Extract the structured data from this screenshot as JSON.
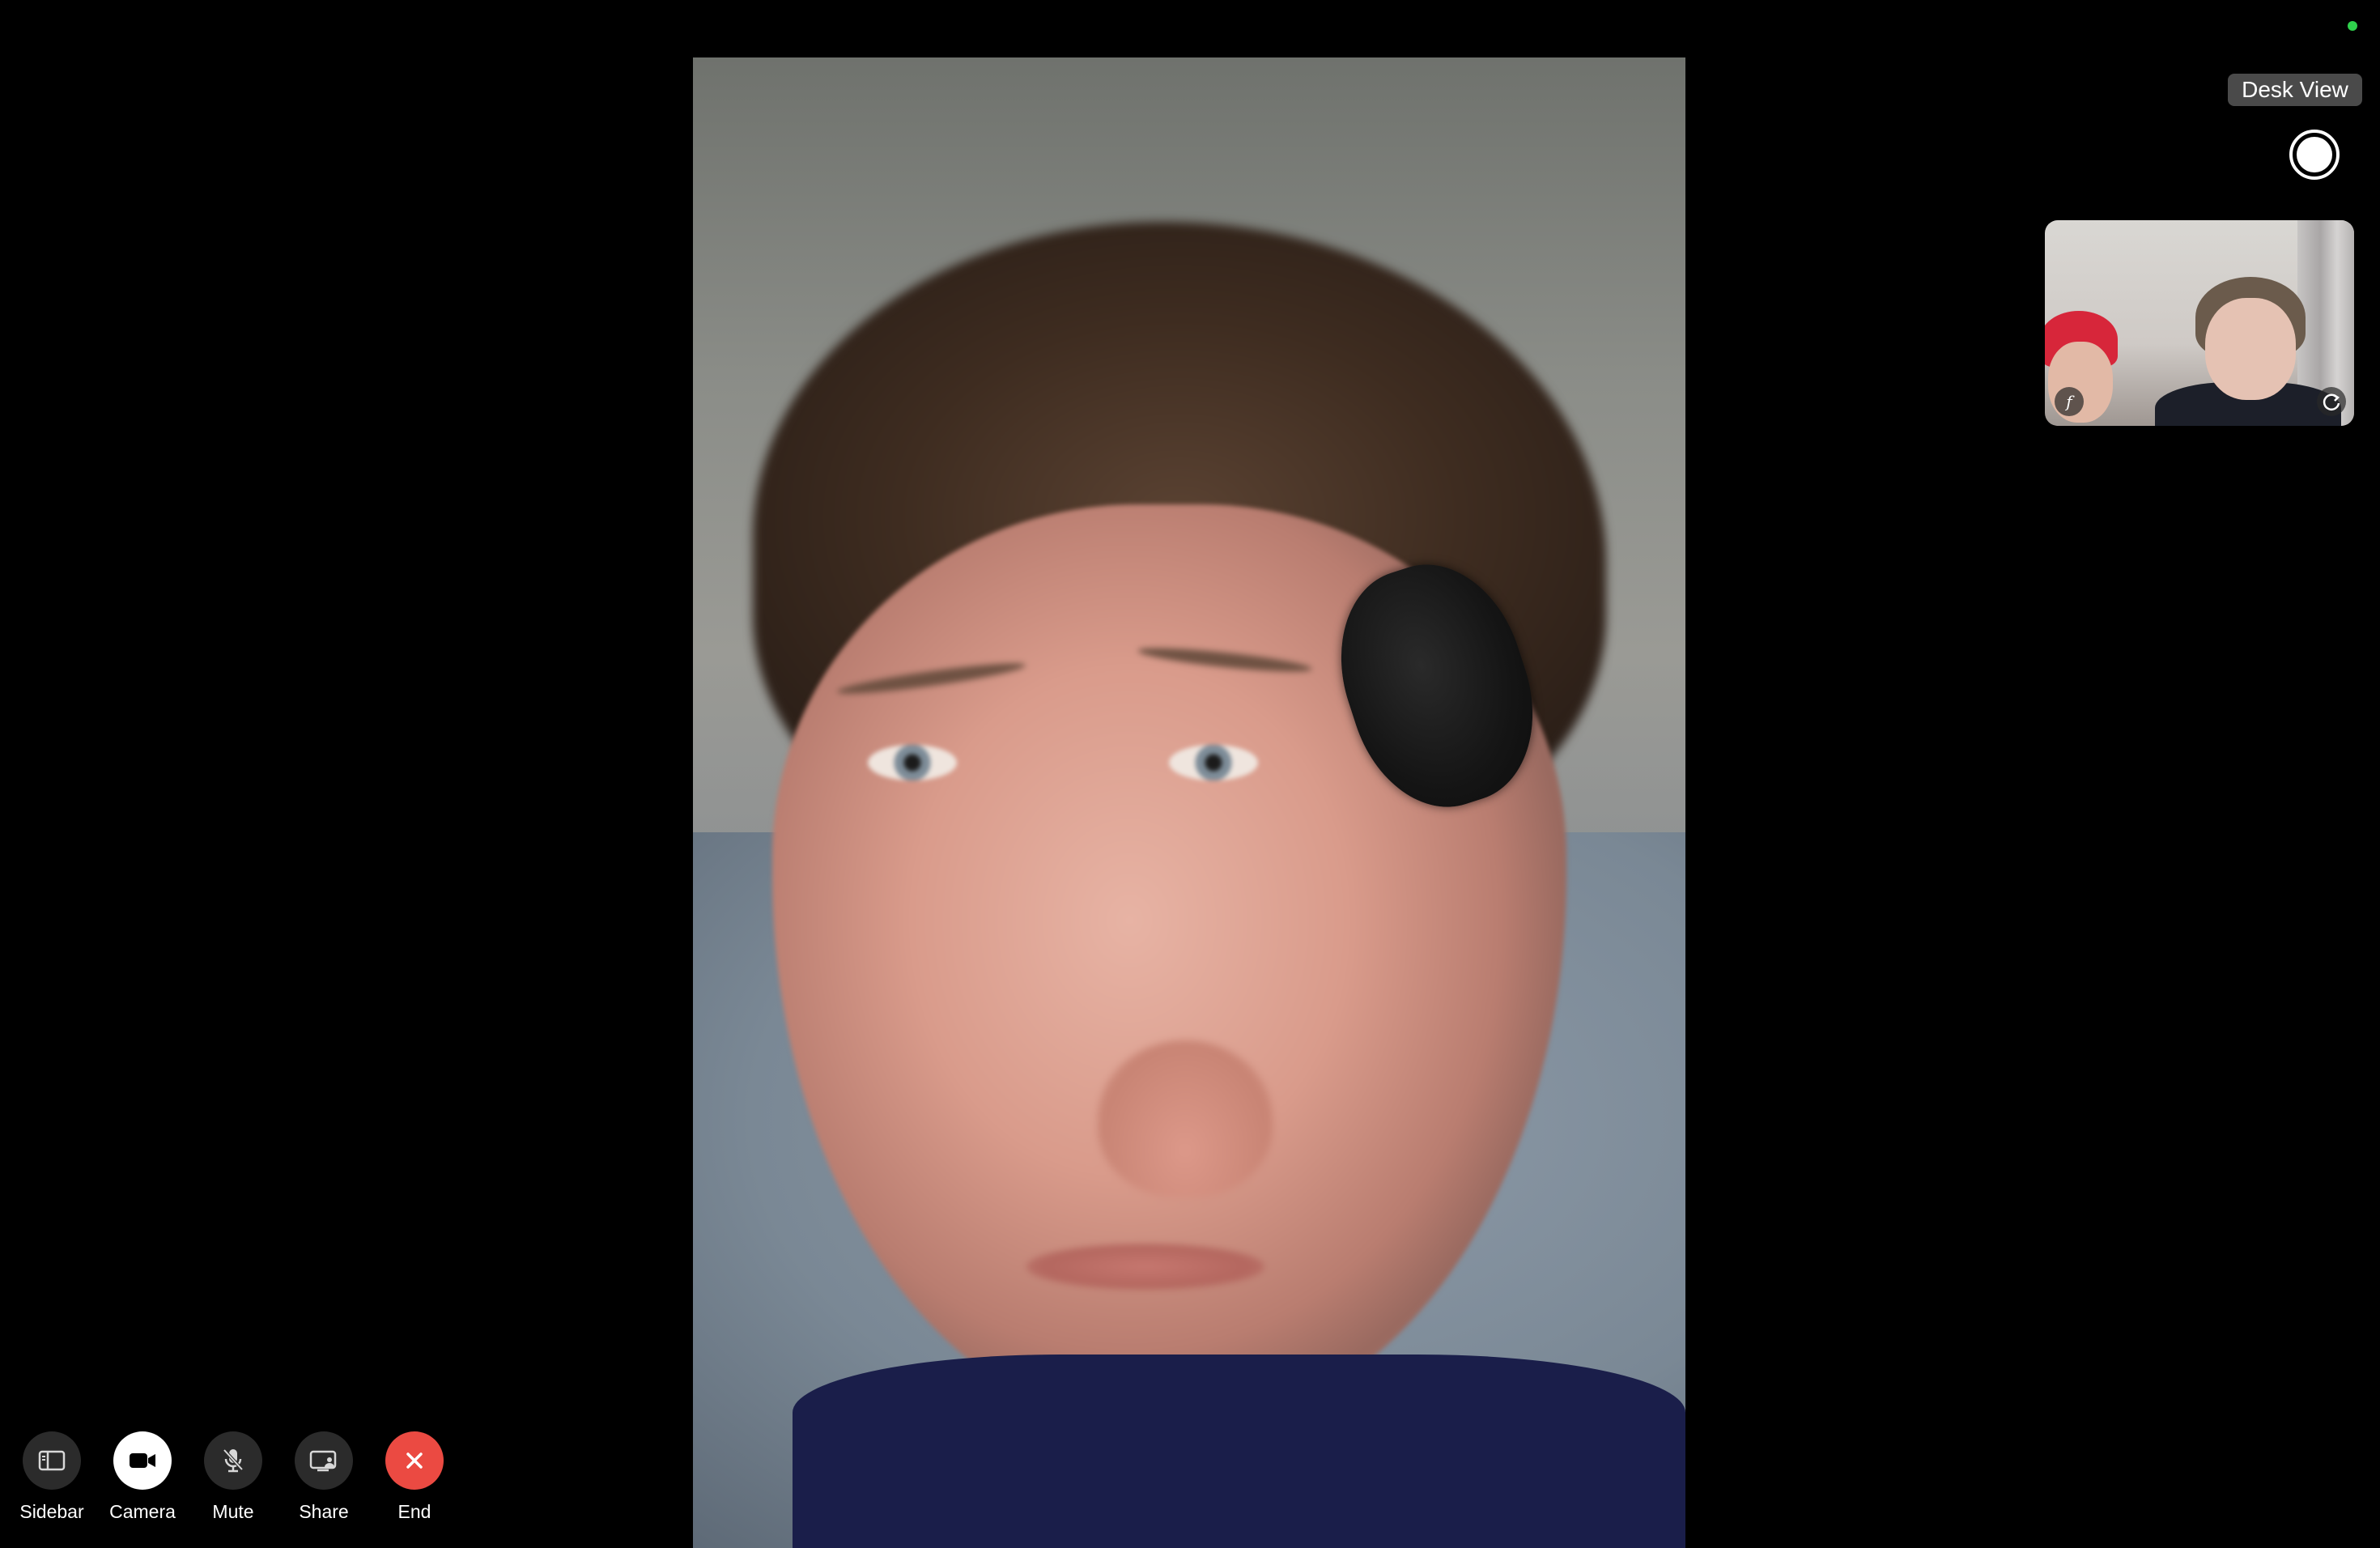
{
  "status": {
    "indicator_color": "#2fd14c"
  },
  "desk_view": {
    "label": "Desk View"
  },
  "controls": {
    "sidebar": {
      "label": "Sidebar",
      "icon": "sidebar-icon"
    },
    "camera": {
      "label": "Camera",
      "icon": "video-camera-icon"
    },
    "mute": {
      "label": "Mute",
      "icon": "microphone-icon"
    },
    "share": {
      "label": "Share",
      "icon": "screen-share-icon"
    },
    "end": {
      "label": "End",
      "icon": "close-icon",
      "color": "#eb4a42"
    }
  },
  "self_view": {
    "left_icon": "effects-icon",
    "right_icon": "flip-camera-icon"
  }
}
